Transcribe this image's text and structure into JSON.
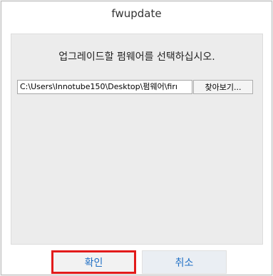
{
  "window": {
    "title": "fwupdate"
  },
  "dialog": {
    "prompt": "업그레이드할 펌웨어를 선택하십시오.",
    "path_value": "C:\\Users\\Innotube150\\Desktop\\펌웨어\\firı",
    "browse_label": "찾아보기...",
    "ok_label": "확인",
    "cancel_label": "취소"
  },
  "colors": {
    "ok_border": "#e21b1b",
    "button_text": "#1f6fc5"
  }
}
